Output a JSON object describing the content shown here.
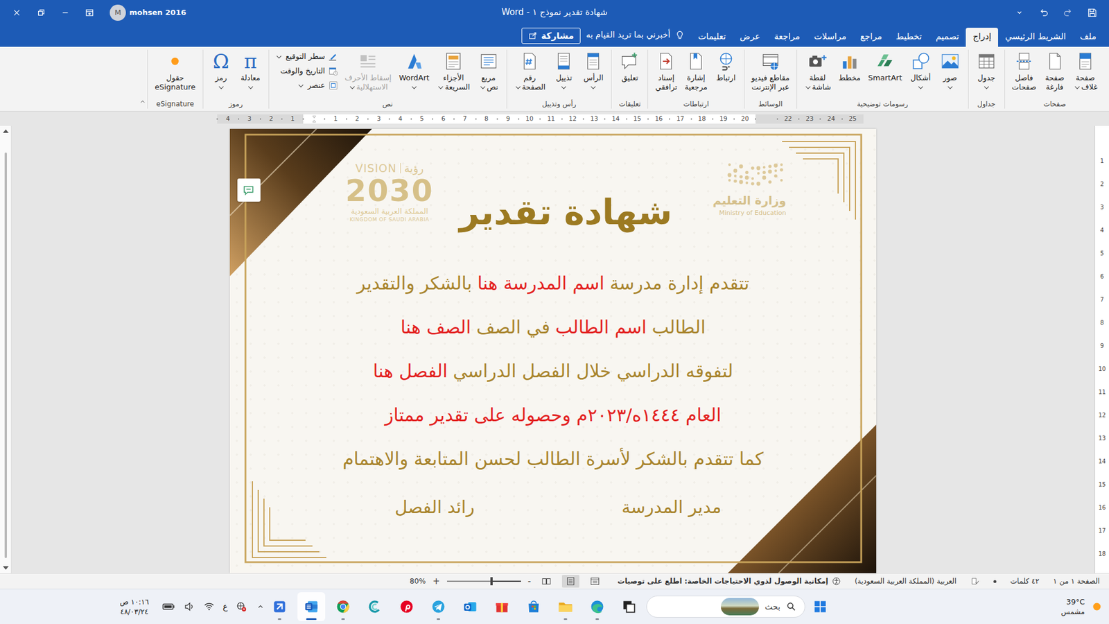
{
  "window": {
    "title": "شهادة تقدير نموذج ١ - Word",
    "user": "mohsen 2016",
    "avatar": "M"
  },
  "tabs": [
    {
      "label": "ملف",
      "selected": false
    },
    {
      "label": "الشريط الرئيسي",
      "selected": false
    },
    {
      "label": "إدراج",
      "selected": true
    },
    {
      "label": "تصميم",
      "selected": false
    },
    {
      "label": "تخطيط",
      "selected": false
    },
    {
      "label": "مراجع",
      "selected": false
    },
    {
      "label": "مراسلات",
      "selected": false
    },
    {
      "label": "مراجعة",
      "selected": false
    },
    {
      "label": "عرض",
      "selected": false
    },
    {
      "label": "تعليمات",
      "selected": false
    }
  ],
  "tell_me": "أخبرني بما تريد القيام به",
  "share": "مشاركة",
  "ribbon": [
    {
      "label": "صفحات",
      "items": [
        {
          "label": [
            "صفحة",
            "غلاف"
          ],
          "kind": "large",
          "dropdown": true,
          "disabled": false
        },
        {
          "label": [
            "صفحة",
            "فارغة"
          ],
          "kind": "large",
          "dropdown": false,
          "disabled": false
        },
        {
          "label": [
            "فاصل",
            "صفحات"
          ],
          "kind": "large",
          "dropdown": false,
          "disabled": false
        }
      ]
    },
    {
      "label": "جداول",
      "items": [
        {
          "label": [
            "جدول"
          ],
          "kind": "large",
          "dropdown": true,
          "disabled": false
        }
      ]
    },
    {
      "label": "رسومات توضيحية",
      "items": [
        {
          "label": [
            "صور"
          ],
          "kind": "large",
          "dropdown": true,
          "disabled": false
        },
        {
          "label": [
            "أشكال"
          ],
          "kind": "large",
          "dropdown": true,
          "disabled": false
        },
        {
          "label": [
            "SmartArt"
          ],
          "kind": "large",
          "dropdown": false,
          "disabled": false
        },
        {
          "label": [
            "مخطط"
          ],
          "kind": "large",
          "dropdown": false,
          "disabled": false
        },
        {
          "label": [
            "لقطة",
            "شاشة"
          ],
          "kind": "large",
          "dropdown": true,
          "disabled": false
        }
      ]
    },
    {
      "label": "الوسائط",
      "items": [
        {
          "label": [
            "مقاطع فيديو",
            "عبر الإنترنت"
          ],
          "kind": "large",
          "dropdown": false,
          "disabled": false
        }
      ]
    },
    {
      "label": "ارتباطات",
      "items": [
        {
          "label": [
            "ارتباط"
          ],
          "kind": "large",
          "dropdown": false,
          "disabled": false
        },
        {
          "label": [
            "إشارة",
            "مرجعية"
          ],
          "kind": "large",
          "dropdown": false,
          "disabled": false
        },
        {
          "label": [
            "إسناد",
            "ترافقي"
          ],
          "kind": "large",
          "dropdown": false,
          "disabled": false
        }
      ]
    },
    {
      "label": "تعليقات",
      "items": [
        {
          "label": [
            "تعليق"
          ],
          "kind": "large",
          "dropdown": false,
          "disabled": false
        }
      ]
    },
    {
      "label": "رأس وتذييل",
      "items": [
        {
          "label": [
            "الرأس"
          ],
          "kind": "large",
          "dropdown": true,
          "disabled": false
        },
        {
          "label": [
            "تذييل"
          ],
          "kind": "large",
          "dropdown": true,
          "disabled": false
        },
        {
          "label": [
            "رقم",
            "الصفحة"
          ],
          "kind": "large",
          "dropdown": true,
          "disabled": false
        }
      ]
    },
    {
      "label": "نص",
      "items": [
        {
          "label": [
            "مربع",
            "نص"
          ],
          "kind": "large",
          "dropdown": true,
          "disabled": false
        },
        {
          "label": [
            "الأجزاء",
            "السريعة"
          ],
          "kind": "large",
          "dropdown": true,
          "disabled": false
        },
        {
          "label": [
            "WordArt"
          ],
          "kind": "large",
          "dropdown": true,
          "disabled": false
        },
        {
          "label": [
            "إسقاط الأحرف",
            "الاستهلالية"
          ],
          "kind": "large",
          "dropdown": true,
          "disabled": true
        },
        {
          "label": [
            "سطر التوقيع"
          ],
          "kind": "small",
          "dropdown": true,
          "disabled": false
        },
        {
          "label": [
            "التاريخ والوقت"
          ],
          "kind": "small",
          "dropdown": false,
          "disabled": false
        },
        {
          "label": [
            "عنصر"
          ],
          "kind": "small",
          "dropdown": true,
          "disabled": false
        }
      ]
    },
    {
      "label": "رموز",
      "items": [
        {
          "label": [
            "معادلة"
          ],
          "kind": "large",
          "dropdown": true,
          "disabled": false,
          "glyph": "π"
        },
        {
          "label": [
            "رمز"
          ],
          "kind": "large",
          "dropdown": true,
          "disabled": false,
          "glyph": "Ω"
        }
      ]
    },
    {
      "label": "eSignature",
      "items": [
        {
          "label": [
            "حقول",
            "eSignature"
          ],
          "kind": "large",
          "dropdown": false,
          "disabled": false
        }
      ]
    }
  ],
  "ruler": {
    "h_left": [
      "4",
      "3",
      "2",
      "1"
    ],
    "h_main": [
      "1",
      "2",
      "3",
      "4",
      "5",
      "6",
      "7",
      "8",
      "9",
      "10",
      "11",
      "12",
      "13",
      "14",
      "15",
      "16",
      "17",
      "18",
      "19",
      "20"
    ],
    "h_right": [
      "22",
      "23",
      "24",
      "25"
    ],
    "vertical": [
      "1",
      "2",
      "3",
      "4",
      "5",
      "6",
      "7",
      "8",
      "9",
      "10",
      "11",
      "12",
      "13",
      "14",
      "15",
      "16",
      "17",
      "18"
    ]
  },
  "document": {
    "logos": {
      "vision": {
        "word": "VISION",
        "arabic": "رؤية",
        "year": "2030",
        "country_ar": "المملكة العربية السعودية",
        "country_en": "KINGDOM OF SAUDI ARABIA"
      },
      "ministry": {
        "ar": "وزارة التعليم",
        "en": "Ministry of Education"
      }
    },
    "title": "شهادة تقدير",
    "lines": [
      [
        {
          "text": "تتقدم إدارة مدرسة",
          "color": "#a8842c"
        },
        {
          "text": "اسم المدرسة هنا",
          "color": "#e3211f"
        },
        {
          "text": "بالشكر والتقدير",
          "color": "#a8842c"
        }
      ],
      [
        {
          "text": "الطالب",
          "color": "#a8842c"
        },
        {
          "text": "اسم الطالب",
          "color": "#e3211f"
        },
        {
          "text": "في الصف",
          "color": "#a8842c"
        },
        {
          "text": "الصف هنا",
          "color": "#e3211f"
        }
      ],
      [
        {
          "text": "لتفوقه الدراسي خلال الفصل الدراسي",
          "color": "#a8842c"
        },
        {
          "text": "الفصل هنا",
          "color": "#e3211f"
        }
      ],
      [
        {
          "text": "العام ١٤٤٤ه/٢٠٢٣م وحصوله على تقدير ممتاز",
          "color": "#e3211f"
        }
      ],
      [
        {
          "text": "كما تتقدم بالشكر لأسرة الطالب لحسن المتابعة والاهتمام",
          "color": "#a8842c"
        }
      ]
    ],
    "signatures": [
      "مدير المدرسة",
      "رائد الفصل"
    ]
  },
  "status_bar": {
    "page": "الصفحة ١ من ١",
    "words": "٤٢ كلمات",
    "language": "العربية (المملكة العربية السعودية)",
    "accessibility": "إمكانية الوصول لذوي الاحتياجات الخاصة: اطلع على توصيات",
    "views": [
      {
        "selected": false
      },
      {
        "selected": true
      },
      {
        "selected": false
      }
    ],
    "zoom": {
      "text": "80%",
      "level": 0.41,
      "zoom_in": "+",
      "zoom_out": "-"
    }
  },
  "taskbar": {
    "weather": {
      "temp": "39°C",
      "desc": "مشمس"
    },
    "search": "بحث",
    "apps": [
      {
        "running": false,
        "selected": false
      },
      {
        "running": true,
        "selected": false
      },
      {
        "running": true,
        "selected": false
      },
      {
        "running": false,
        "selected": false
      },
      {
        "running": false,
        "selected": false
      },
      {
        "running": false,
        "selected": false
      },
      {
        "running": true,
        "selected": false
      },
      {
        "running": false,
        "selected": false
      },
      {
        "running": false,
        "selected": false
      },
      {
        "running": true,
        "selected": false
      },
      {
        "running": true,
        "selected": true
      },
      {
        "running": true,
        "selected": false
      }
    ],
    "lang": "ع",
    "time": "١٠:١٦ ص",
    "date": "٤٨/٠٣/٢٤"
  }
}
